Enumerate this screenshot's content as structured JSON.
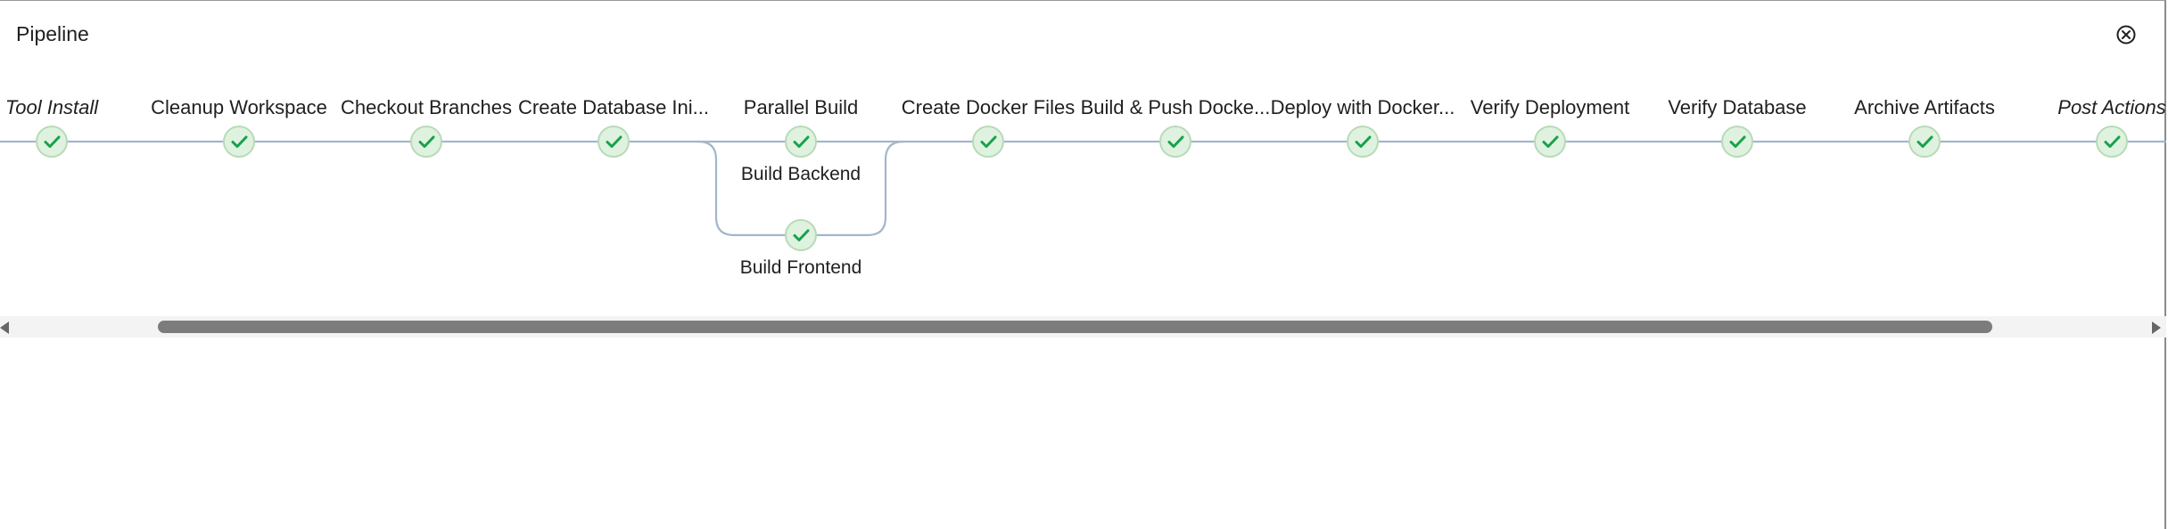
{
  "panel": {
    "title": "Pipeline",
    "close_icon": "close-circle-icon"
  },
  "colors": {
    "success_fill": "#dff2df",
    "success_check": "#17a24a",
    "connector": "#a4b6c9"
  },
  "stages": [
    {
      "label": "Tool Install",
      "status": "success",
      "italic": true
    },
    {
      "label": "Cleanup Workspace",
      "status": "success"
    },
    {
      "label": "Checkout Branches",
      "status": "success"
    },
    {
      "label": "Create Database Ini...",
      "status": "success"
    },
    {
      "label": "Parallel Build",
      "status": "success",
      "branches": [
        {
          "label": "Build Backend",
          "status": "success"
        },
        {
          "label": "Build Frontend",
          "status": "success"
        }
      ]
    },
    {
      "label": "Create Docker Files",
      "status": "success"
    },
    {
      "label": "Build & Push Docke...",
      "status": "success"
    },
    {
      "label": "Deploy with Docker...",
      "status": "success"
    },
    {
      "label": "Verify Deployment",
      "status": "success"
    },
    {
      "label": "Verify Database",
      "status": "success"
    },
    {
      "label": "Archive Artifacts",
      "status": "success"
    },
    {
      "label": "Post Actions",
      "status": "success",
      "italic": true
    }
  ],
  "scrollbar": {
    "visible_fraction": 0.85,
    "scroll_position": 0.07
  }
}
